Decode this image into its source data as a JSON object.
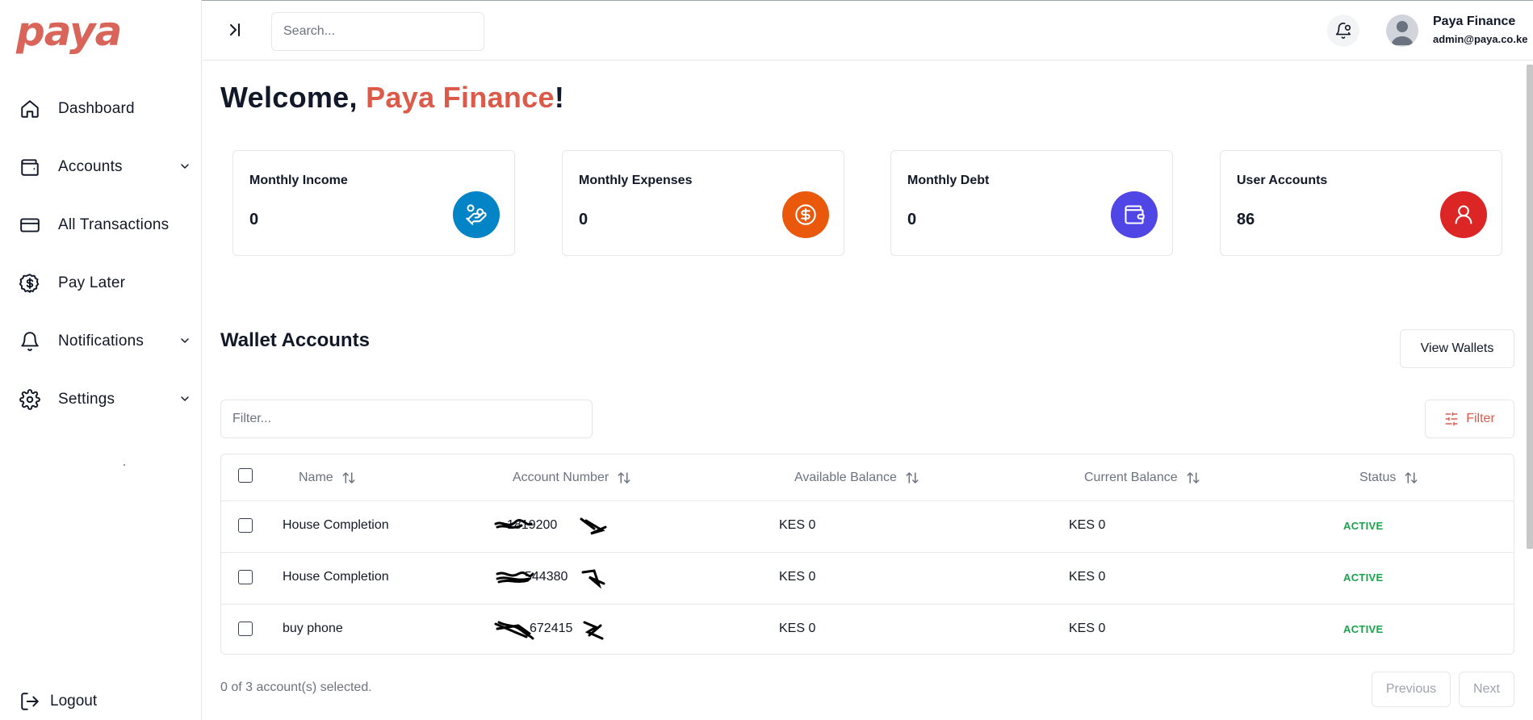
{
  "brand": {
    "logo_text": "paya",
    "logo_color": "#d9645a"
  },
  "sidebar": {
    "items": [
      {
        "label": "Dashboard",
        "icon": "home-icon",
        "has_chevron": false
      },
      {
        "label": "Accounts",
        "icon": "wallet-icon",
        "has_chevron": true
      },
      {
        "label": "All Transactions",
        "icon": "credit-card-icon",
        "has_chevron": false
      },
      {
        "label": "Pay Later",
        "icon": "badge-dollar-icon",
        "has_chevron": false
      },
      {
        "label": "Notifications",
        "icon": "bell-icon",
        "has_chevron": true
      },
      {
        "label": "Settings",
        "icon": "gear-icon",
        "has_chevron": true
      }
    ],
    "logout_label": "Logout"
  },
  "header": {
    "search_placeholder": "Search...",
    "user_name": "Paya Finance",
    "user_email": "admin@paya.co.ke"
  },
  "welcome": {
    "prefix": "Welcome, ",
    "name": "Paya Finance",
    "suffix": "!"
  },
  "stats": [
    {
      "title": "Monthly Income",
      "value": "0",
      "color": "#0284c7",
      "icon": "hand-coins-icon"
    },
    {
      "title": "Monthly Expenses",
      "value": "0",
      "color": "#ea580c",
      "icon": "dollar-circle-icon"
    },
    {
      "title": "Monthly Debt",
      "value": "0",
      "color": "#4f46e5",
      "icon": "wallet-icon"
    },
    {
      "title": "User Accounts",
      "value": "86",
      "color": "#dc2626",
      "icon": "user-icon"
    }
  ],
  "wallets": {
    "title": "Wallet Accounts",
    "view_button": "View Wallets",
    "filter_placeholder": "Filter...",
    "filter_button": "Filter",
    "columns": [
      "Name",
      "Account Number",
      "Available Balance",
      "Current Balance",
      "Status"
    ],
    "rows": [
      {
        "name": "House Completion",
        "account": "1819200",
        "available": "KES 0",
        "current": "KES 0",
        "status": "ACTIVE"
      },
      {
        "name": "House Completion",
        "account": "544380",
        "available": "KES 0",
        "current": "KES 0",
        "status": "ACTIVE"
      },
      {
        "name": "buy phone",
        "account": "672415",
        "available": "KES 0",
        "current": "KES 0",
        "status": "ACTIVE"
      }
    ],
    "selection_text": "0 of 3 account(s) selected.",
    "prev_label": "Previous",
    "next_label": "Next"
  },
  "colors": {
    "accent": "#dc5a4a",
    "status_active": "#16a34a"
  }
}
